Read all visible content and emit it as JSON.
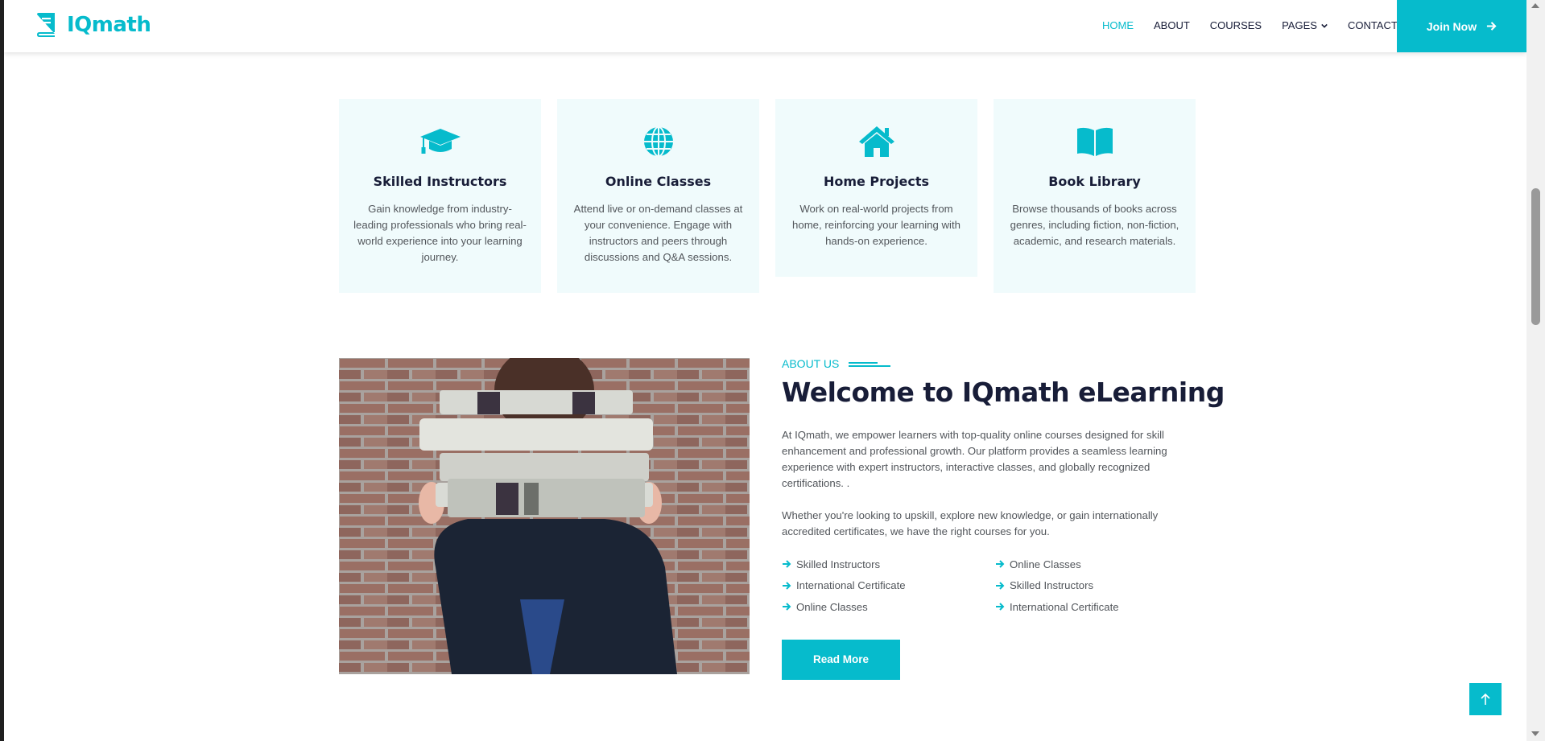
{
  "brand": {
    "name": "IQmath",
    "icon": "book-icon",
    "color": "#06BBCC"
  },
  "nav": {
    "items": [
      {
        "label": "HOME",
        "active": true
      },
      {
        "label": "ABOUT"
      },
      {
        "label": "COURSES"
      },
      {
        "label": "PAGES",
        "dropdown": true
      },
      {
        "label": "CONTACT"
      }
    ],
    "join_label": "Join Now"
  },
  "services": [
    {
      "icon": "graduation-cap-icon",
      "title": "Skilled Instructors",
      "text": "Gain knowledge from industry-leading professionals who bring real-world experience into your learning journey."
    },
    {
      "icon": "globe-icon",
      "title": "Online Classes",
      "text": "Attend live or on-demand classes at your convenience. Engage with instructors and peers through discussions and Q&A sessions."
    },
    {
      "icon": "home-icon",
      "title": "Home Projects",
      "text": "Work on real-world projects from home, reinforcing your learning with hands-on experience."
    },
    {
      "icon": "book-open-icon",
      "title": "Book Library",
      "text": "Browse thousands of books across genres, including fiction, non-fiction, academic, and research materials."
    }
  ],
  "about": {
    "tag": "About Us",
    "heading": "Welcome to IQmath eLearning",
    "para1": "At IQmath, we empower learners with top-quality online courses designed for skill enhancement and professional growth. Our platform provides a seamless learning experience with expert instructors, interactive classes, and globally recognized certifications. .",
    "para2": "Whether you're looking to upskill, explore new knowledge, or gain internationally accredited certificates, we have the right courses for you.",
    "features": [
      "Skilled Instructors",
      "Online Classes",
      "International Certificate",
      "Skilled Instructors",
      "Online Classes",
      "International Certificate"
    ],
    "read_more": "Read More",
    "image": "person-holding-books-photo"
  },
  "back_to_top_icon": "arrow-up-icon"
}
